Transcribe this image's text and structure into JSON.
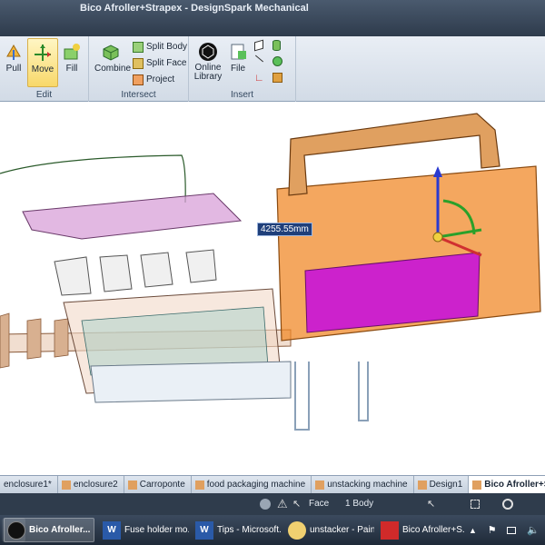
{
  "window": {
    "title": "Bico Afroller+Strapex - DesignSpark Mechanical"
  },
  "ribbon": {
    "edit": {
      "label": "Edit",
      "pull": "Pull",
      "move": "Move",
      "fill": "Fill"
    },
    "intersect": {
      "label": "Intersect",
      "combine": "Combine",
      "split_body": "Split Body",
      "split_face": "Split Face",
      "project": "Project"
    },
    "insert": {
      "label": "Insert",
      "online_library": "Online Library",
      "file": "File"
    }
  },
  "viewport": {
    "measurement": "4255.55mm"
  },
  "doc_tabs": [
    {
      "label": "enclosure1*",
      "active": false
    },
    {
      "label": "enclosure2",
      "active": false
    },
    {
      "label": "Carroponte",
      "active": false
    },
    {
      "label": "food packaging machine",
      "active": false
    },
    {
      "label": "unstacking machine",
      "active": false
    },
    {
      "label": "Design1",
      "active": false
    },
    {
      "label": "Bico Afroller+Stra",
      "active": true
    }
  ],
  "status": {
    "selection_type": "Face",
    "selection_count": "1 Body"
  },
  "taskbar": {
    "items": [
      {
        "label": "Bico Afroller...",
        "icon": "designspark-icon",
        "active": true
      },
      {
        "label": "Fuse holder mo...",
        "icon": "word-icon",
        "active": false
      },
      {
        "label": "Tips - Microsoft...",
        "icon": "word-icon",
        "active": false
      },
      {
        "label": "unstacker - Paint",
        "icon": "paint-icon",
        "active": false
      },
      {
        "label": "Bico Afroller+S...",
        "icon": "pdf-icon",
        "active": false
      }
    ]
  },
  "colors": {
    "orange_body": "#f08a2a",
    "magenta_face": "#cc22cc",
    "pink_hopper": "#d8a0d8",
    "accent": "#f8d86a"
  }
}
